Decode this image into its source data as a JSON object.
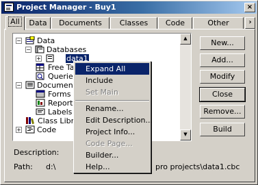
{
  "window": {
    "title": "Project Manager - Buy1"
  },
  "tabs": [
    {
      "label": "All"
    },
    {
      "label": "Data"
    },
    {
      "label": "Documents"
    },
    {
      "label": "Classes"
    },
    {
      "label": "Code"
    },
    {
      "label": "Other"
    }
  ],
  "tree": {
    "items": [
      {
        "label": "Data"
      },
      {
        "label": "Databases"
      },
      {
        "label": "data1"
      },
      {
        "label": "Free Ta"
      },
      {
        "label": "Queries"
      },
      {
        "label": "Documents"
      },
      {
        "label": "Forms"
      },
      {
        "label": "Reports"
      },
      {
        "label": "Labels"
      },
      {
        "label": "Class Libra"
      },
      {
        "label": "Code"
      }
    ]
  },
  "buttons": {
    "new": "New...",
    "add": "Add...",
    "modify": "Modify",
    "close": "Close",
    "remove": "Remove...",
    "build": "Build"
  },
  "footer": {
    "description_label": "Description:",
    "path_label": "Path:",
    "path_value": "d:\\",
    "path_tail": "pro projects\\data1.cbc"
  },
  "context_menu": {
    "items": [
      {
        "label": "Expand All",
        "state": "highlighted"
      },
      {
        "label": "Include",
        "state": "normal"
      },
      {
        "label": "Set Main",
        "state": "disabled"
      },
      {
        "label": "Rename...",
        "state": "normal"
      },
      {
        "label": "Edit Description...",
        "state": "normal"
      },
      {
        "label": "Project Info...",
        "state": "normal"
      },
      {
        "label": "Code Page...",
        "state": "disabled"
      },
      {
        "label": "Builder...",
        "state": "normal"
      },
      {
        "label": "Help...",
        "state": "normal"
      }
    ]
  },
  "colors": {
    "title_start": "#0a246a",
    "title_end": "#a6caf0",
    "face": "#d4d0c8",
    "highlight": "#0a246a"
  }
}
